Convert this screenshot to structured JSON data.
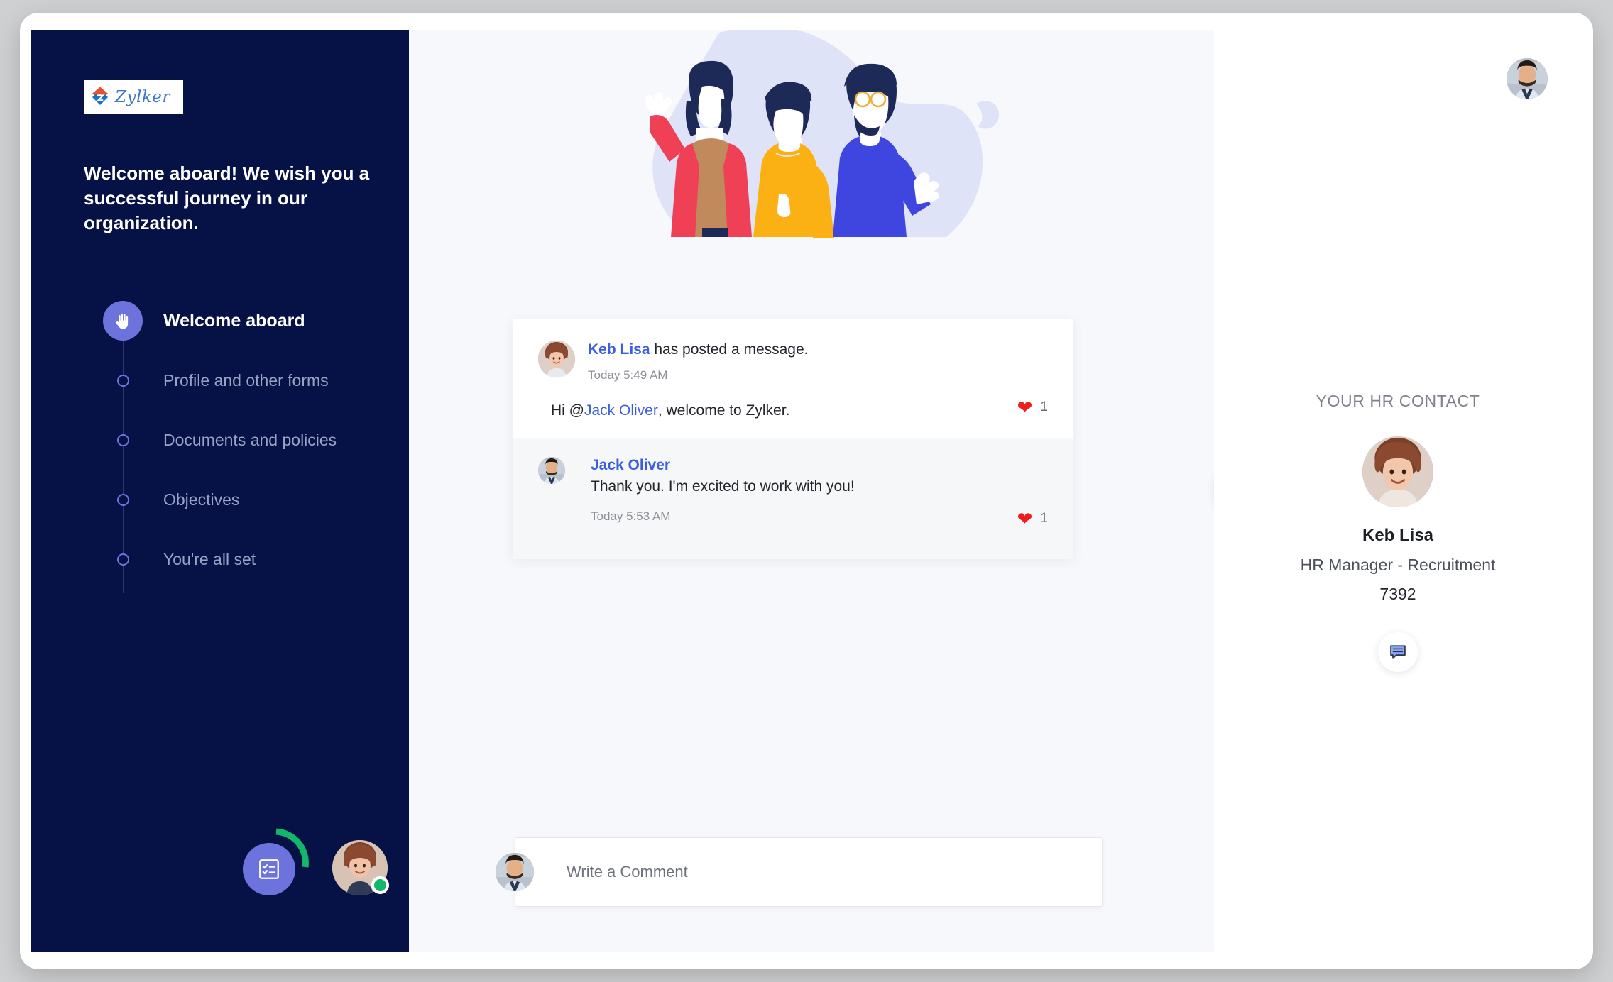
{
  "brand": {
    "name": "Zylker",
    "logo_icon": "zylker-chevron-logo"
  },
  "sidebar": {
    "welcome_message": "Welcome aboard! We wish you a successful journey in our organization.",
    "steps": [
      {
        "label": "Welcome aboard",
        "icon": "waving-hand-icon",
        "active": true
      },
      {
        "label": "Profile and other forms",
        "active": false
      },
      {
        "label": "Documents and policies",
        "active": false
      },
      {
        "label": "Objectives",
        "active": false
      },
      {
        "label": "You're all set",
        "active": false
      }
    ],
    "footer": {
      "checklist_icon": "checklist-icon",
      "status": "online"
    }
  },
  "main": {
    "hero_illustration": "three-people-welcome-illustration",
    "thread": {
      "messages": [
        {
          "author": "Keb Lisa",
          "title_suffix": " has posted a message.",
          "time": "Today 5:49 AM",
          "body_prefix": "Hi @",
          "mention": "Jack Oliver",
          "body_suffix": ", welcome to Zylker.",
          "reaction_icon": "heart-icon",
          "reaction_count": "1"
        },
        {
          "author": "Jack Oliver",
          "text": "Thank you. I'm excited to work with you!",
          "time": "Today 5:53 AM",
          "reaction_icon": "heart-icon",
          "reaction_count": "1"
        }
      ]
    },
    "chat_fab_icon": "double-chat-bubble-icon",
    "comment": {
      "placeholder": "Write a Comment",
      "value": ""
    }
  },
  "right_panel": {
    "top_avatar_icon": "user-avatar",
    "hr_contact": {
      "label": "YOUR HR CONTACT",
      "name": "Keb Lisa",
      "role": "HR Manager - Recruitment",
      "extension": "7392",
      "chat_icon": "chat-bubble-icon"
    }
  },
  "colors": {
    "sidebar_bg": "#061146",
    "accent_purple": "#6d73dd",
    "link_blue": "#3b5fe0",
    "heart_red": "#f01d1d",
    "online_green": "#12b76a"
  }
}
